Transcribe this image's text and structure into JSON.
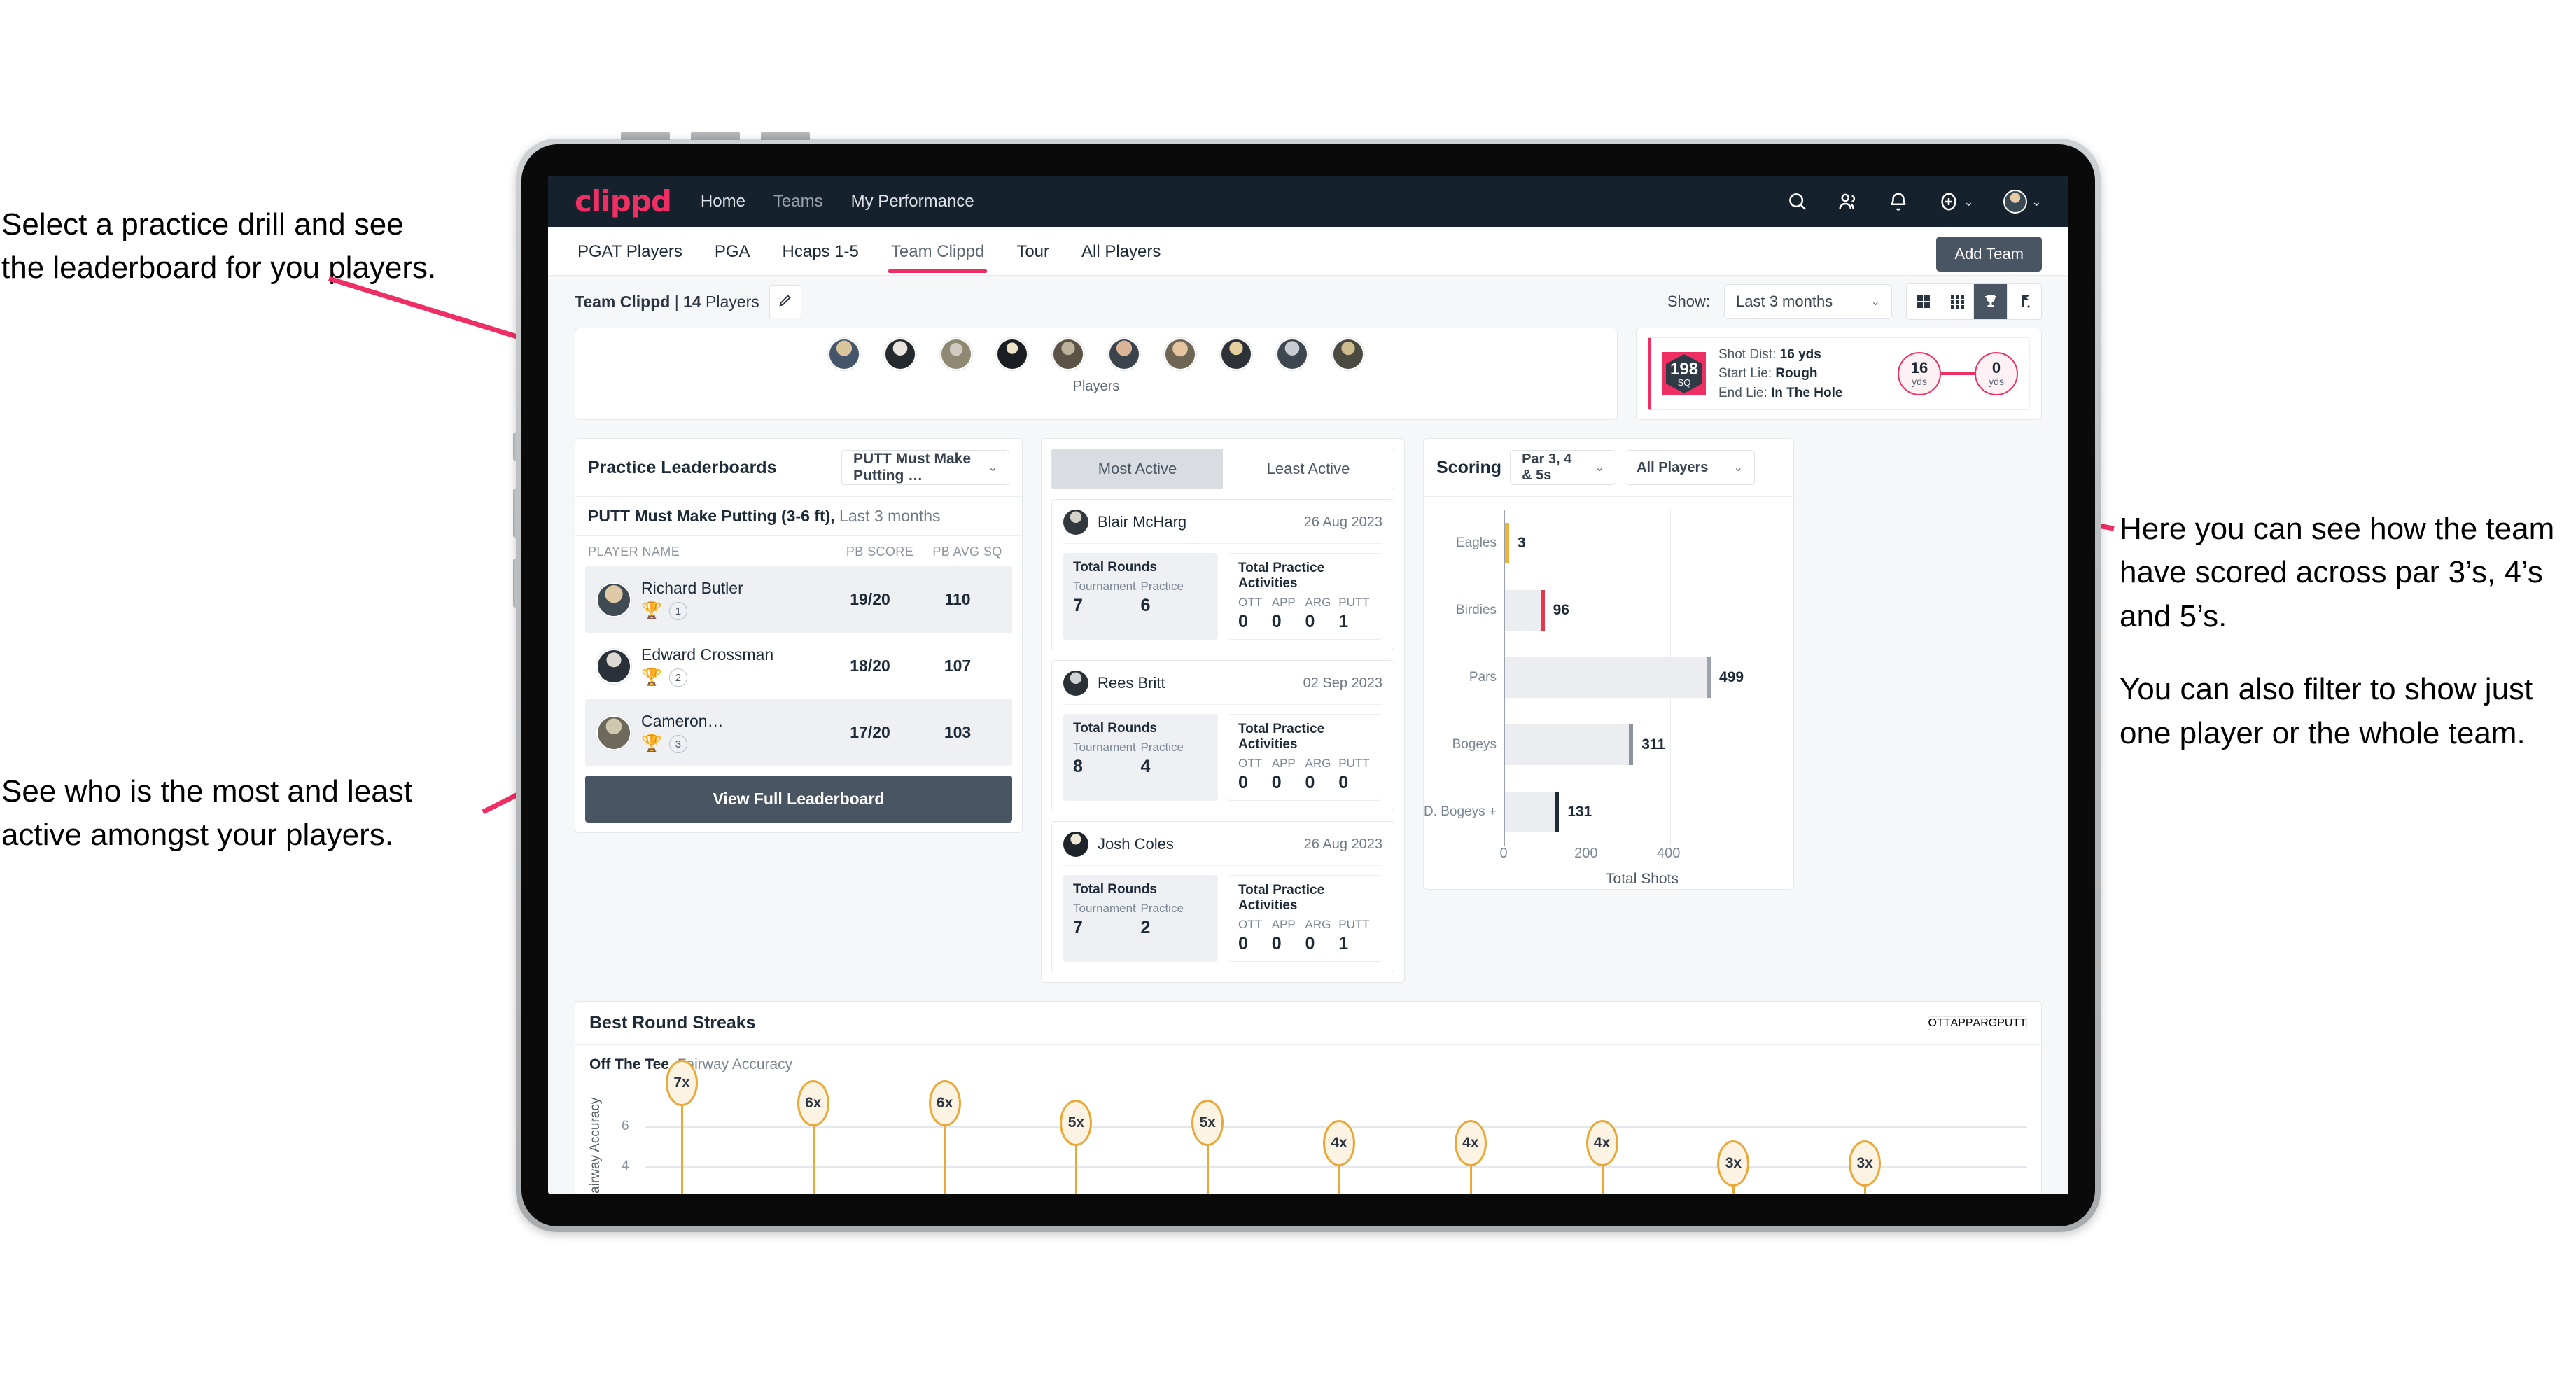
{
  "annotations": {
    "top_left": [
      "Select a practice drill and see",
      "the leaderboard for you players."
    ],
    "bottom_left": [
      "See who is the most and least",
      "active amongst your players."
    ],
    "right": [
      "Here you can see how the team have scored across par 3’s, 4’s and 5’s.",
      "You can also filter to show just one player or the whole team."
    ]
  },
  "navbar": {
    "logo": "clippd",
    "links": [
      {
        "label": "Home",
        "active": true
      },
      {
        "label": "Teams",
        "active": false
      },
      {
        "label": "My Performance",
        "active": true
      }
    ],
    "icons": [
      "search-icon",
      "people-icon",
      "bell-icon",
      "plus-circle-icon",
      "avatar"
    ]
  },
  "subtabs": {
    "items": [
      "PGAT Players",
      "PGA",
      "Hcaps 1-5",
      "Team Clippd",
      "Tour",
      "All Players"
    ],
    "active": "Team Clippd",
    "add_team_label": "Add Team"
  },
  "toolbar": {
    "team_name": "Team Clippd",
    "team_separator": " | ",
    "player_count": "14",
    "players_word": " Players",
    "edit_icon": "pencil-icon",
    "show_label": "Show:",
    "show_value": "Last 3 months",
    "views": [
      {
        "name": "grid-large-icon",
        "active": false
      },
      {
        "name": "grid-small-icon",
        "active": false
      },
      {
        "name": "trophy-icon",
        "active": true
      },
      {
        "name": "golf-flag-icon",
        "active": false
      }
    ]
  },
  "players_card": {
    "caption": "Players",
    "count": 10
  },
  "shot_card": {
    "sq_value": "198",
    "sq_label": "SQ",
    "lines": [
      {
        "label": "Shot Dist:",
        "value": "16 yds"
      },
      {
        "label": "Start Lie:",
        "value": "Rough"
      },
      {
        "label": "End Lie:",
        "value": "In The Hole"
      }
    ],
    "start_dot": {
      "value": "16",
      "unit": "yds"
    },
    "end_dot": {
      "value": "0",
      "unit": "yds"
    }
  },
  "leaderboard": {
    "title": "Practice Leaderboards",
    "drill_select": "PUTT Must Make Putting …",
    "subtitle_bold": "PUTT Must Make Putting (3-6 ft),",
    "subtitle_light": " Last 3 months",
    "columns": [
      "PLAYER NAME",
      "PB SCORE",
      "PB AVG SQ"
    ],
    "rows": [
      {
        "name": "Richard Butler",
        "rank": "1",
        "trophy": "gold",
        "score": "19/20",
        "avg": "110"
      },
      {
        "name": "Edward Crossman",
        "rank": "2",
        "trophy": "silver",
        "score": "18/20",
        "avg": "107"
      },
      {
        "name": "Cameron…",
        "rank": "3",
        "trophy": "bronze",
        "score": "17/20",
        "avg": "103"
      }
    ],
    "button": "View Full Leaderboard"
  },
  "activity": {
    "tabs": [
      {
        "label": "Most Active",
        "active": true
      },
      {
        "label": "Least Active",
        "active": false
      }
    ],
    "rounds_heading": "Total Rounds",
    "rounds_labels": [
      "Tournament",
      "Practice"
    ],
    "practice_heading": "Total Practice Activities",
    "practice_labels": [
      "OTT",
      "APP",
      "ARG",
      "PUTT"
    ],
    "players": [
      {
        "name": "Blair McHarg",
        "date": "26 Aug 2023",
        "tournament": "7",
        "practice": "6",
        "ott": "0",
        "app": "0",
        "arg": "0",
        "putt": "1"
      },
      {
        "name": "Rees Britt",
        "date": "02 Sep 2023",
        "tournament": "8",
        "practice": "4",
        "ott": "0",
        "app": "0",
        "arg": "0",
        "putt": "0"
      },
      {
        "name": "Josh Coles",
        "date": "26 Aug 2023",
        "tournament": "7",
        "practice": "2",
        "ott": "0",
        "app": "0",
        "arg": "0",
        "putt": "1"
      }
    ]
  },
  "scoring": {
    "title": "Scoring",
    "par_select": "Par 3, 4 & 5s",
    "player_select": "All Players"
  },
  "streaks": {
    "title": "Best Round Streaks",
    "tabs": [
      {
        "label": "OTT",
        "active": true
      },
      {
        "label": "APP",
        "active": false
      },
      {
        "label": "ARG",
        "active": false
      },
      {
        "label": "PUTT",
        "active": false
      }
    ],
    "subtitle_bold": "Off The Tee,",
    "subtitle_light": " Fairway Accuracy",
    "ylabel": "reak, Fairway Accuracy",
    "yticks": [
      "6",
      "4"
    ]
  },
  "chart_data": [
    {
      "type": "bar",
      "orientation": "horizontal",
      "title": "Scoring",
      "categories": [
        "Eagles",
        "Birdies",
        "Pars",
        "Bogeys",
        "D. Bogeys +"
      ],
      "values": [
        3,
        96,
        499,
        311,
        131
      ],
      "cap_colors": [
        "#efb43a",
        "#e8354a",
        "#9aa3ad",
        "#8b949e",
        "#1d2a38"
      ],
      "xlabel": "Total Shots",
      "ylabel": "",
      "xticks": [
        0,
        200,
        400
      ],
      "xlim": [
        0,
        560
      ],
      "grid": true,
      "legend": "none"
    },
    {
      "type": "scatter",
      "title": "Best Round Streaks",
      "subtitle": "Off The Tee, Fairway Accuracy",
      "ylabel": "Streak, Fairway Accuracy",
      "yticks": [
        4,
        6
      ],
      "ylim": [
        0,
        8
      ],
      "values": [
        7,
        6,
        6,
        5,
        5,
        4,
        4,
        4,
        3,
        3
      ],
      "labels": [
        "7x",
        "6x",
        "6x",
        "5x",
        "5x",
        "4x",
        "4x",
        "4x",
        "3x",
        "3x"
      ],
      "grid": true,
      "legend": "none"
    }
  ]
}
